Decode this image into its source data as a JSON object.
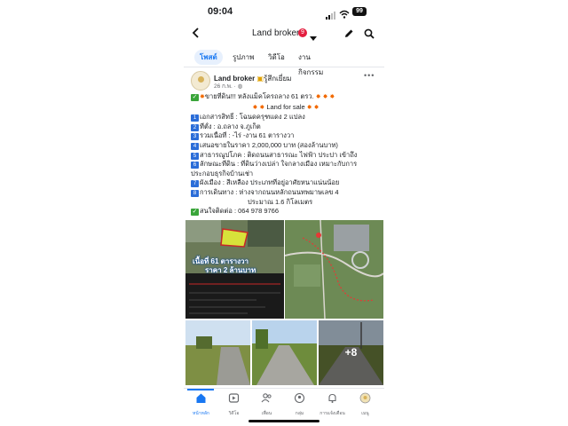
{
  "status_bar": {
    "time": "09:04",
    "battery": "99"
  },
  "header": {
    "title": "Land broker",
    "badge": "9"
  },
  "tabs": [
    {
      "label": "โพสต์",
      "active": true
    },
    {
      "label": "รูปภาพ",
      "active": false
    },
    {
      "label": "วิดีโอ",
      "active": false
    },
    {
      "label": "งานกิจกรรม",
      "active": false
    }
  ],
  "post": {
    "author": "Land broker",
    "feeling": "รู้สึกเยี่ยม",
    "meta": "26 ก.พ. · ",
    "lines": {
      "title": "ขายที่ดิน!!! หลังแม็คโครถลาง 61 ตรว.",
      "sale": "Land for sale",
      "l1": "เอกสารสิทธิ์ : โฉนดครุฑแดง 2 แปลง",
      "l2": "ที่ตั้ง : อ.ถลาง จ.ภูเก็ต",
      "l3": "รวมเนื้อที่ : -ไร่ -งาน 61 ตารางวา",
      "l4": "เสนอขายในราคา 2,000,000 บาท (สองล้านบาท)",
      "l5": "สาธารณูปโภค : ติดถนนสาธารณะ ไฟฟ้า ประปา เข้าถึง",
      "l6a": "ลักษณะที่ดิน : ที่ดินว่างเปล่า ใจกลางเมือง เหมาะกับการ",
      "l6b": "ประกอบธุรกิจบ้านเช่า",
      "l7": "ผังเมือง : สีเหลือง ประเภทที่อยู่อาศัยหนาแน่นน้อย",
      "l8a": "การเดินทาง : ห่างจากถนนหลักถนนทพมาษเลข 4",
      "l8b": "ประมาณ 1.6 กิโลเมตร",
      "contact": "สนใจติดต่อ : 064 978 9766"
    },
    "numbers": [
      "1",
      "2",
      "3",
      "4",
      "5",
      "6",
      "7",
      "8"
    ],
    "photo_overlay_1": "เนื้อที่ 61 ตารางวา",
    "photo_overlay_2": "ราคา 2 ล้านบาท",
    "more_photos": "+8"
  },
  "bottom_nav": [
    {
      "label": "หน้าหลัก",
      "icon": "home-icon"
    },
    {
      "label": "วิดีโอ",
      "icon": "video-icon"
    },
    {
      "label": "เพื่อน",
      "icon": "friends-icon"
    },
    {
      "label": "กลุ่ม",
      "icon": "groups-icon"
    },
    {
      "label": "การแจ้งเตือน",
      "icon": "bell-icon"
    },
    {
      "label": "เมนู",
      "icon": "profile-menu-icon"
    }
  ],
  "colors": {
    "accent": "#1877f2",
    "badge": "#e41e3f",
    "number_box": "#2b6dd8",
    "check": "#3aa53a"
  }
}
